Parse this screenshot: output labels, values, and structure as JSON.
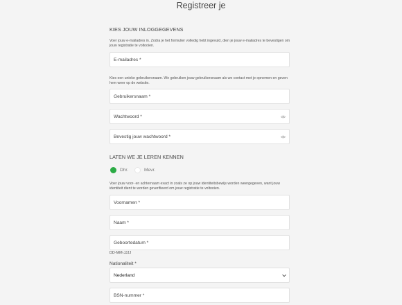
{
  "header": {
    "title": "Registreer je"
  },
  "login_section": {
    "title": "KIES JOUW INLOGGEGEVENS",
    "email_help": "Voer jouw e-mailadres in. Zodra je het formulier volledig hebt ingevuld, dien je jouw e-mailadres te bevestigen om jouw registratie te voltooien.",
    "email_label": "E-mailadres *",
    "username_help": "Kies een unieke gebruikersnaam. We gebruiken jouw gebruikersnaam als we contact met je opnemen en geven hem weer op de website.",
    "username_label": "Gebruikersnaam *",
    "password_label": "Wachtwoord *",
    "password_confirm_label": "Bevestig jouw wachtwoord *"
  },
  "personal_section": {
    "title": "LATEN WE JE LEREN KENNEN",
    "salutation": {
      "option_1": "Dhr.",
      "option_2": "Mevr.",
      "selected": "Dhr."
    },
    "name_help": "Voer jouw voor- en achternaam exact in zoals ze op jouw identiteitsbewijs worden weergegeven, want jouw identiteit dient te worden geverifieerd om jouw registratie te voltooien.",
    "firstname_label": "Voornamen *",
    "lastname_label": "Naam *",
    "birthdate_label": "Geboortedatum *",
    "birthdate_hint": "DD-MM-JJJJ",
    "nationality_label": "Nationaliteit *",
    "nationality_value": "Nederland",
    "bsn_label": "BSN-nummer *"
  },
  "colors": {
    "accent_green": "#2bab45",
    "field_border": "#e1e1e1",
    "page_background": "#f4f4f4"
  },
  "icons": {
    "password_toggle": "eye-icon",
    "select_arrow": "chevron-down-icon"
  }
}
